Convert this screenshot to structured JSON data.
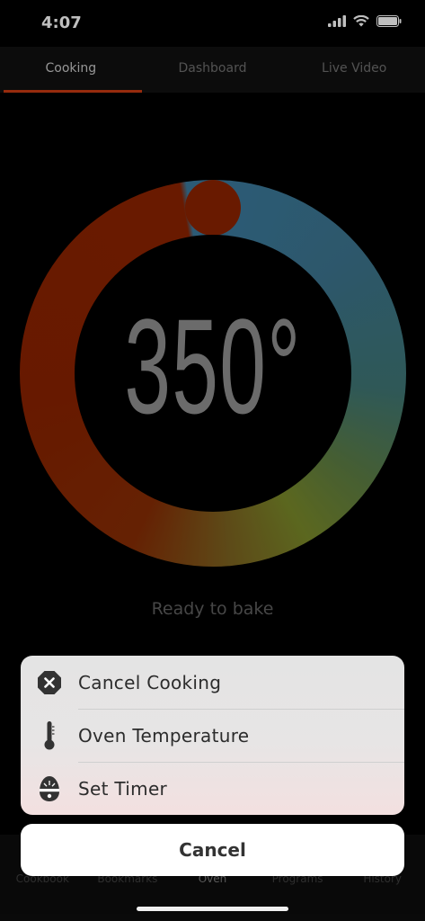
{
  "status_bar": {
    "time": "4:07"
  },
  "top_tabs": [
    {
      "label": "Cooking",
      "active": true
    },
    {
      "label": "Dashboard",
      "active": false
    },
    {
      "label": "Live Video",
      "active": false
    }
  ],
  "dial": {
    "temperature": "350°",
    "status": "Ready to bake"
  },
  "bottom_nav": [
    {
      "label": "Cookbook"
    },
    {
      "label": "Bookmarks"
    },
    {
      "label": "Oven",
      "active": true
    },
    {
      "label": "Programs"
    },
    {
      "label": "History"
    }
  ],
  "action_sheet": {
    "items": [
      {
        "label": "Cancel Cooking",
        "icon": "close-octagon-icon"
      },
      {
        "label": "Oven Temperature",
        "icon": "thermometer-icon"
      },
      {
        "label": "Set Timer",
        "icon": "egg-timer-icon"
      }
    ],
    "cancel_label": "Cancel"
  },
  "colors": {
    "accent": "#c83a12",
    "dial_red": "#8c2300",
    "dial_blue": "#3b7a9e",
    "dial_olive": "#7a8a2a"
  }
}
